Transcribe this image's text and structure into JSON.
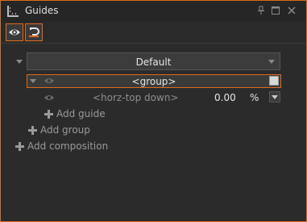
{
  "window": {
    "title": "Guides",
    "icons": [
      "guides-icon",
      "pin-icon",
      "maximize-icon",
      "close-icon"
    ]
  },
  "toolbar": {
    "buttons": [
      "eye-toggle-icon",
      "snap-magnet-icon"
    ]
  },
  "composition": {
    "selected": "Default"
  },
  "group": {
    "label": "<group>",
    "checked": true
  },
  "guide": {
    "label": "<horz-top down>",
    "value": "0.00",
    "unit": "%"
  },
  "actions": {
    "add_guide": "Add guide",
    "add_group": "Add group",
    "add_composition": "Add composition"
  },
  "colors": {
    "accent": "#e06a1a",
    "background": "#2b2b2b"
  }
}
